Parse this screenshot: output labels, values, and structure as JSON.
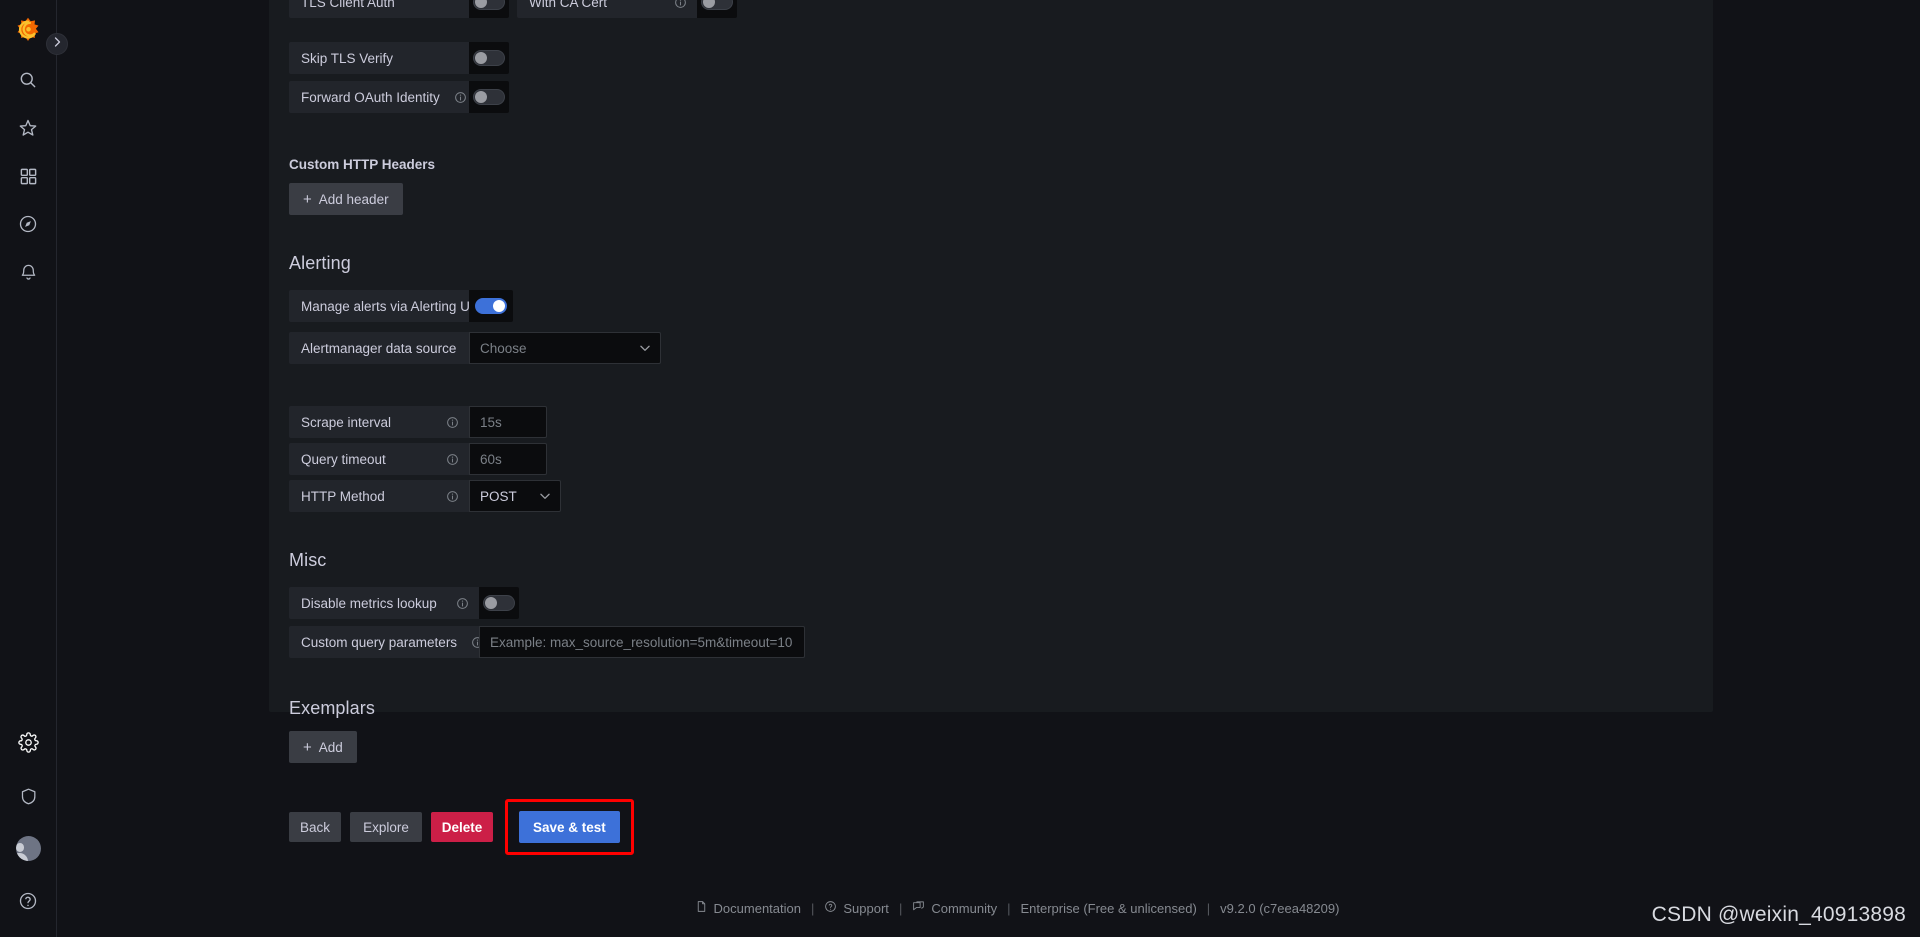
{
  "nav": {
    "logo_icon": "grafana-logo-icon",
    "expand_icon": "chevron-right-icon",
    "items": [
      {
        "name": "search",
        "icon": "search-icon"
      },
      {
        "name": "starred",
        "icon": "star-icon"
      },
      {
        "name": "dashboards",
        "icon": "dashboards-grid-icon"
      },
      {
        "name": "explore",
        "icon": "compass-icon"
      },
      {
        "name": "alerting",
        "icon": "bell-icon"
      }
    ],
    "bottom_items": [
      {
        "name": "configuration",
        "icon": "gear-icon"
      },
      {
        "name": "server-admin",
        "icon": "shield-icon"
      },
      {
        "name": "profile",
        "icon": "avatar-icon"
      },
      {
        "name": "help",
        "icon": "question-circle-icon"
      }
    ]
  },
  "tls": {
    "client_auth_label": "TLS Client Auth",
    "client_auth_enabled": false,
    "with_ca_cert_label": "With CA Cert",
    "with_ca_cert_enabled": false,
    "skip_tls_verify_label": "Skip TLS Verify",
    "skip_tls_verify_enabled": false,
    "forward_oauth_label": "Forward OAuth Identity",
    "forward_oauth_enabled": false
  },
  "custom_headers": {
    "title": "Custom HTTP Headers",
    "add_header_label": "Add header"
  },
  "alerting": {
    "title": "Alerting",
    "manage_alerts_label": "Manage alerts via Alerting UI",
    "manage_alerts_enabled": true,
    "alertmanager_label": "Alertmanager data source",
    "alertmanager_placeholder": "Choose"
  },
  "intervals": {
    "scrape_interval_label": "Scrape interval",
    "scrape_interval_placeholder": "15s",
    "query_timeout_label": "Query timeout",
    "query_timeout_placeholder": "60s",
    "http_method_label": "HTTP Method",
    "http_method_value": "POST"
  },
  "misc": {
    "title": "Misc",
    "disable_metrics_lookup_label": "Disable metrics lookup",
    "disable_metrics_lookup_enabled": false,
    "custom_query_params_label": "Custom query parameters",
    "custom_query_params_placeholder": "Example: max_source_resolution=5m&timeout=10"
  },
  "exemplars": {
    "title": "Exemplars",
    "add_label": "Add"
  },
  "actions": {
    "back_label": "Back",
    "explore_label": "Explore",
    "delete_label": "Delete",
    "save_test_label": "Save & test",
    "highlight_color": "#ff0000"
  },
  "footer": {
    "documentation": "Documentation",
    "support": "Support",
    "community": "Community",
    "license": "Enterprise (Free & unlicensed)",
    "version": "v9.2.0 (c7eea48209)",
    "separator": "|"
  },
  "watermark": {
    "text": "CSDN @weixin_40913898"
  },
  "colors": {
    "accent_blue": "#3d71d9",
    "danger_pink": "#cc1f47",
    "panel_bg": "#181b1f",
    "page_bg": "#111217",
    "label_bg": "#22252b"
  }
}
